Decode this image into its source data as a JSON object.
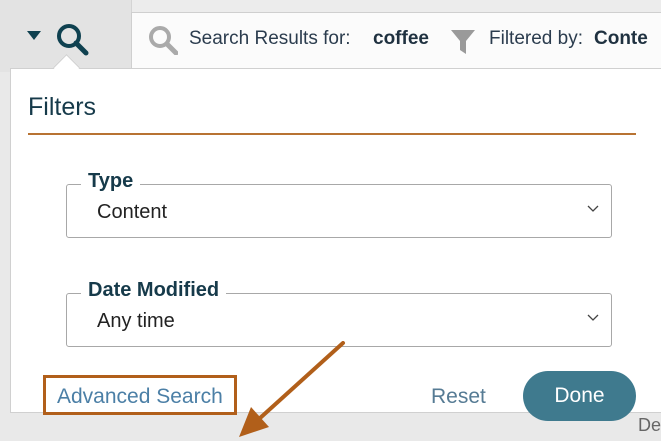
{
  "topbar": {
    "results_label": "Search Results for:",
    "query": "coffee",
    "filtered_label": "Filtered by:",
    "filtered_value": "Conte"
  },
  "popup": {
    "title": "Filters",
    "type_field": {
      "label": "Type",
      "value": "Content"
    },
    "date_field": {
      "label": "Date Modified",
      "value": "Any time"
    },
    "advanced_link": "Advanced Search",
    "reset_label": "Reset",
    "done_label": "Done"
  },
  "background": {
    "partial_text": "De"
  },
  "icons": [
    "caret-down-icon",
    "search-icon",
    "filter-icon",
    "chevron-down-icon",
    "annotation-arrow"
  ],
  "colors": {
    "accent": "#b87333",
    "primary_button": "#3f7a8e",
    "title": "#163a4a",
    "link": "#4b7fa6"
  }
}
